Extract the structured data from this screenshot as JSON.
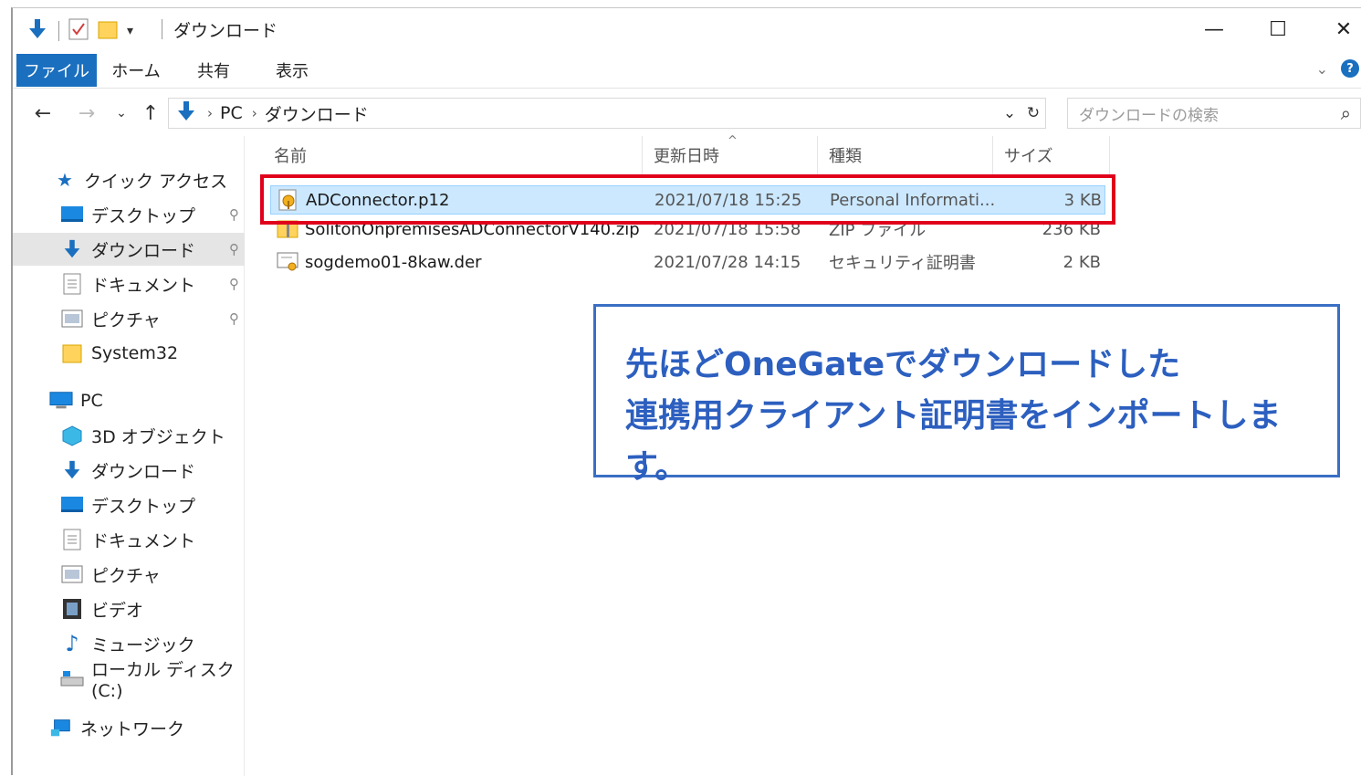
{
  "window": {
    "title": "ダウンロード",
    "controls": {
      "minimize": "—",
      "maximize": "☐",
      "close": "✕"
    }
  },
  "ribbon": {
    "tabs": [
      "ファイル",
      "ホーム",
      "共有",
      "表示"
    ]
  },
  "address": {
    "breadcrumbs": [
      "PC",
      "ダウンロード"
    ],
    "search_placeholder": "ダウンロードの検索"
  },
  "sidebar": {
    "quick_access": "クイック アクセス",
    "quick_items": [
      {
        "label": "デスクトップ",
        "icon": "desktop-icon",
        "pinned": true
      },
      {
        "label": "ダウンロード",
        "icon": "download-icon",
        "pinned": true,
        "selected": true
      },
      {
        "label": "ドキュメント",
        "icon": "document-icon",
        "pinned": true
      },
      {
        "label": "ピクチャ",
        "icon": "picture-icon",
        "pinned": true
      },
      {
        "label": "System32",
        "icon": "folder-icon",
        "pinned": false
      }
    ],
    "pc": "PC",
    "pc_items": [
      {
        "label": "3D オブジェクト",
        "icon": "3d-object-icon"
      },
      {
        "label": "ダウンロード",
        "icon": "download-icon"
      },
      {
        "label": "デスクトップ",
        "icon": "desktop-icon"
      },
      {
        "label": "ドキュメント",
        "icon": "document-icon"
      },
      {
        "label": "ピクチャ",
        "icon": "picture-icon"
      },
      {
        "label": "ビデオ",
        "icon": "video-icon"
      },
      {
        "label": "ミュージック",
        "icon": "music-icon"
      },
      {
        "label": "ローカル ディスク (C:)",
        "icon": "disk-icon"
      }
    ],
    "network": "ネットワーク"
  },
  "columns": {
    "name": "名前",
    "date": "更新日時",
    "type": "種類",
    "size": "サイズ"
  },
  "files": [
    {
      "name": "ADConnector.p12",
      "date": "2021/07/18 15:25",
      "type": "Personal Informati...",
      "size": "3 KB",
      "icon": "certificate-key-icon",
      "selected": true
    },
    {
      "name": "SolitonOnpremisesADConnectorV140.zip",
      "date": "2021/07/18 15:58",
      "type": "ZIP ファイル",
      "size": "236 KB",
      "icon": "zip-icon",
      "selected": false
    },
    {
      "name": "sogdemo01-8kaw.der",
      "date": "2021/07/28 14:15",
      "type": "セキュリティ証明書",
      "size": "2 KB",
      "icon": "certificate-icon",
      "selected": false
    }
  ],
  "callout": {
    "line1": "先ほどOneGateでダウンロードした",
    "line2": "連携用クライアント証明書をインポートします。"
  },
  "colors": {
    "accent": "#1a6fbf",
    "highlight": "#e0001b",
    "callout": "#2c5fbf",
    "selection": "#cce8ff"
  }
}
